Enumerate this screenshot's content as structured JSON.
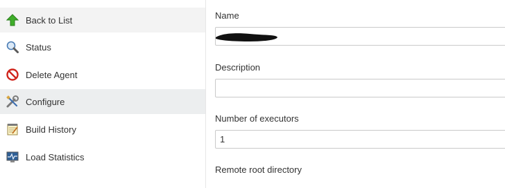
{
  "sidebar": {
    "items": [
      {
        "label": "Back to List",
        "icon": "up-arrow-icon"
      },
      {
        "label": "Status",
        "icon": "magnifier-icon"
      },
      {
        "label": "Delete Agent",
        "icon": "no-entry-icon"
      },
      {
        "label": "Configure",
        "icon": "wrench-screwdriver-icon"
      },
      {
        "label": "Build History",
        "icon": "notepad-icon"
      },
      {
        "label": "Load Statistics",
        "icon": "monitor-graph-icon"
      }
    ]
  },
  "form": {
    "name": {
      "label": "Name",
      "value": ""
    },
    "description": {
      "label": "Description",
      "value": ""
    },
    "executors": {
      "label": "Number of executors",
      "value": "1"
    },
    "remote_root": {
      "label": "Remote root directory"
    }
  },
  "colors": {
    "sidebar_selected": "#eceeef",
    "sidebar_shaded": "#f3f3f3",
    "input_border": "#c9c9c9",
    "text": "#333333"
  }
}
